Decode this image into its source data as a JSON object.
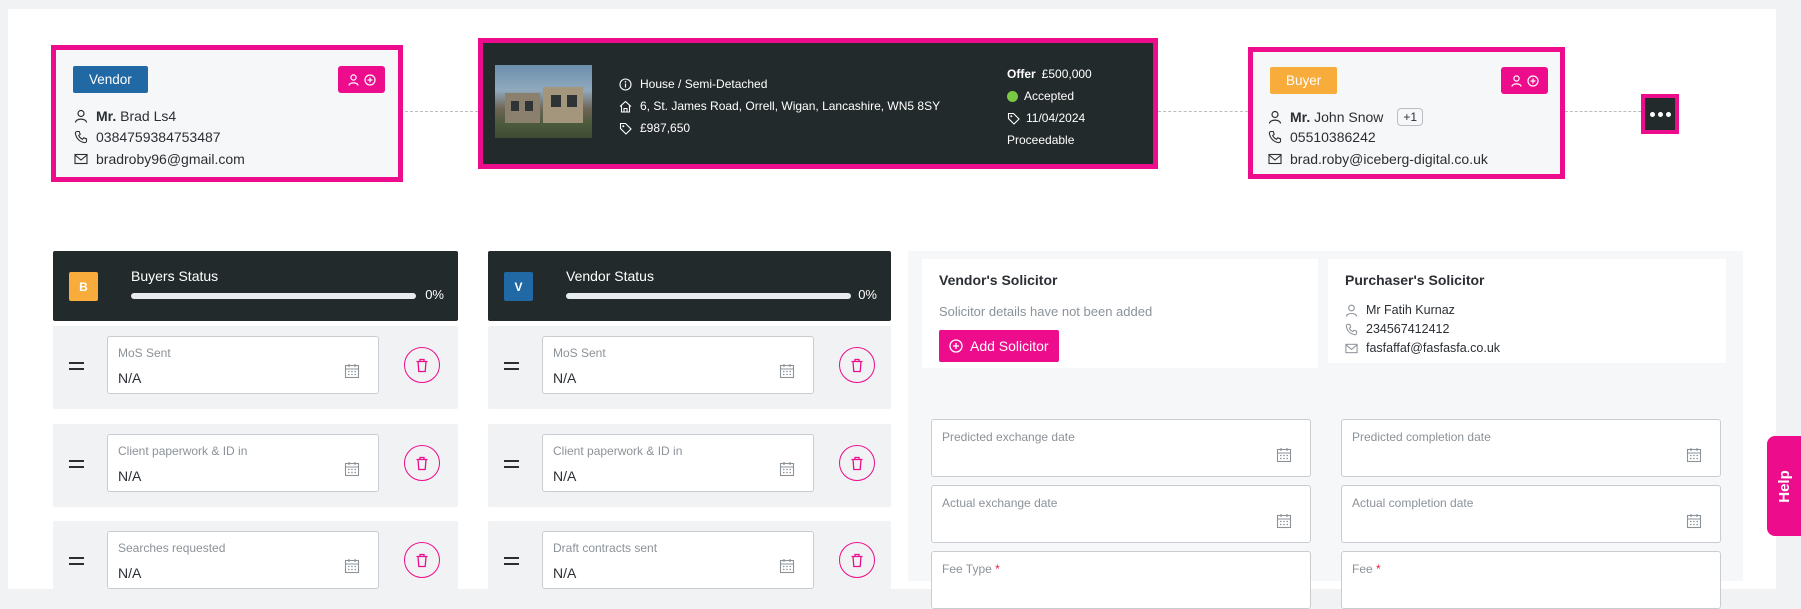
{
  "vendor": {
    "badge": "Vendor",
    "title": "Mr.",
    "name": "Brad Ls4",
    "phone": "0384759384753487",
    "email": "bradroby96@gmail.com"
  },
  "property": {
    "type": "House / Semi-Detached",
    "address": "6, St. James Road, Orrell, Wigan, Lancashire, WN5 8SY",
    "price": "£987,650",
    "offer_label": "Offer",
    "offer_amount": "£500,000",
    "status": "Accepted",
    "date": "11/04/2024",
    "proceedable": "Proceedable"
  },
  "buyer": {
    "badge": "Buyer",
    "title": "Mr.",
    "name": "John Snow",
    "extra": "+1",
    "phone": "05510386242",
    "email": "brad.roby@iceberg-digital.co.uk"
  },
  "buyers_status": {
    "letter": "B",
    "title": "Buyers Status",
    "percent_label": "0%",
    "progress": 0,
    "tasks": [
      {
        "label": "MoS Sent",
        "value": "N/A"
      },
      {
        "label": "Client paperwork & ID in",
        "value": "N/A"
      },
      {
        "label": "Searches requested",
        "value": "N/A"
      }
    ]
  },
  "vendor_status": {
    "letter": "V",
    "title": "Vendor Status",
    "percent_label": "0%",
    "progress": 0,
    "tasks": [
      {
        "label": "MoS Sent",
        "value": "N/A"
      },
      {
        "label": "Client paperwork & ID in",
        "value": "N/A"
      },
      {
        "label": "Draft contracts sent",
        "value": "N/A"
      }
    ]
  },
  "vendor_solicitor": {
    "title": "Vendor's Solicitor",
    "empty_text": "Solicitor details have not been added",
    "add_label": "Add Solicitor"
  },
  "purchaser_solicitor": {
    "title": "Purchaser's Solicitor",
    "name": "Mr Fatih Kurnaz",
    "phone": "234567412412",
    "email": "fasfaffaf@fasfasfa.co.uk"
  },
  "dates": {
    "predicted_exchange": "Predicted exchange date",
    "predicted_completion": "Predicted completion date",
    "actual_exchange": "Actual exchange date",
    "actual_completion": "Actual completion date",
    "fee_type": "Fee Type",
    "fee": "Fee",
    "required_mark": "*"
  },
  "help_label": "Help",
  "colors": {
    "accent": "#ec0c8c",
    "vendor": "#2169a4",
    "buyer": "#f7ac3b",
    "dark": "#232a2b",
    "accepted": "#7ac943"
  }
}
